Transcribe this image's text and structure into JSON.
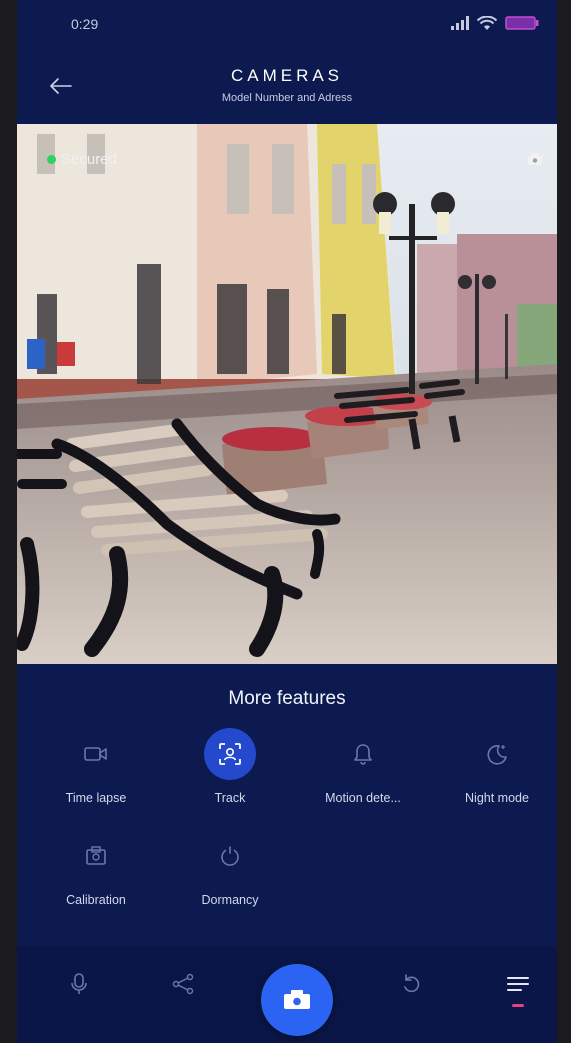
{
  "status_bar": {
    "time": "0:29"
  },
  "header": {
    "title": "CAMERAS",
    "subtitle": "Model Number and Adress"
  },
  "feed": {
    "status_label": "Secured"
  },
  "features": {
    "title": "More features",
    "items": [
      {
        "label": "Time lapse",
        "icon": "video-icon",
        "active": false
      },
      {
        "label": "Track",
        "icon": "face-track-icon",
        "active": true
      },
      {
        "label": "Motion dete...",
        "icon": "bell-icon",
        "active": false
      },
      {
        "label": "Night mode",
        "icon": "moon-icon",
        "active": false
      },
      {
        "label": "Calibration",
        "icon": "calibration-icon",
        "active": false
      },
      {
        "label": "Dormancy",
        "icon": "power-icon",
        "active": false
      }
    ]
  },
  "bottom_nav": {
    "items": [
      "microphone-icon",
      "share-icon",
      "camera-icon",
      "replay-icon",
      "menu-icon"
    ],
    "active": "menu-icon"
  },
  "colors": {
    "background": "#0c1a4f",
    "accent": "#2b63f3",
    "active_feature": "#2449cc",
    "secured_dot": "#2fd262",
    "nav_indicator": "#e0457f"
  }
}
